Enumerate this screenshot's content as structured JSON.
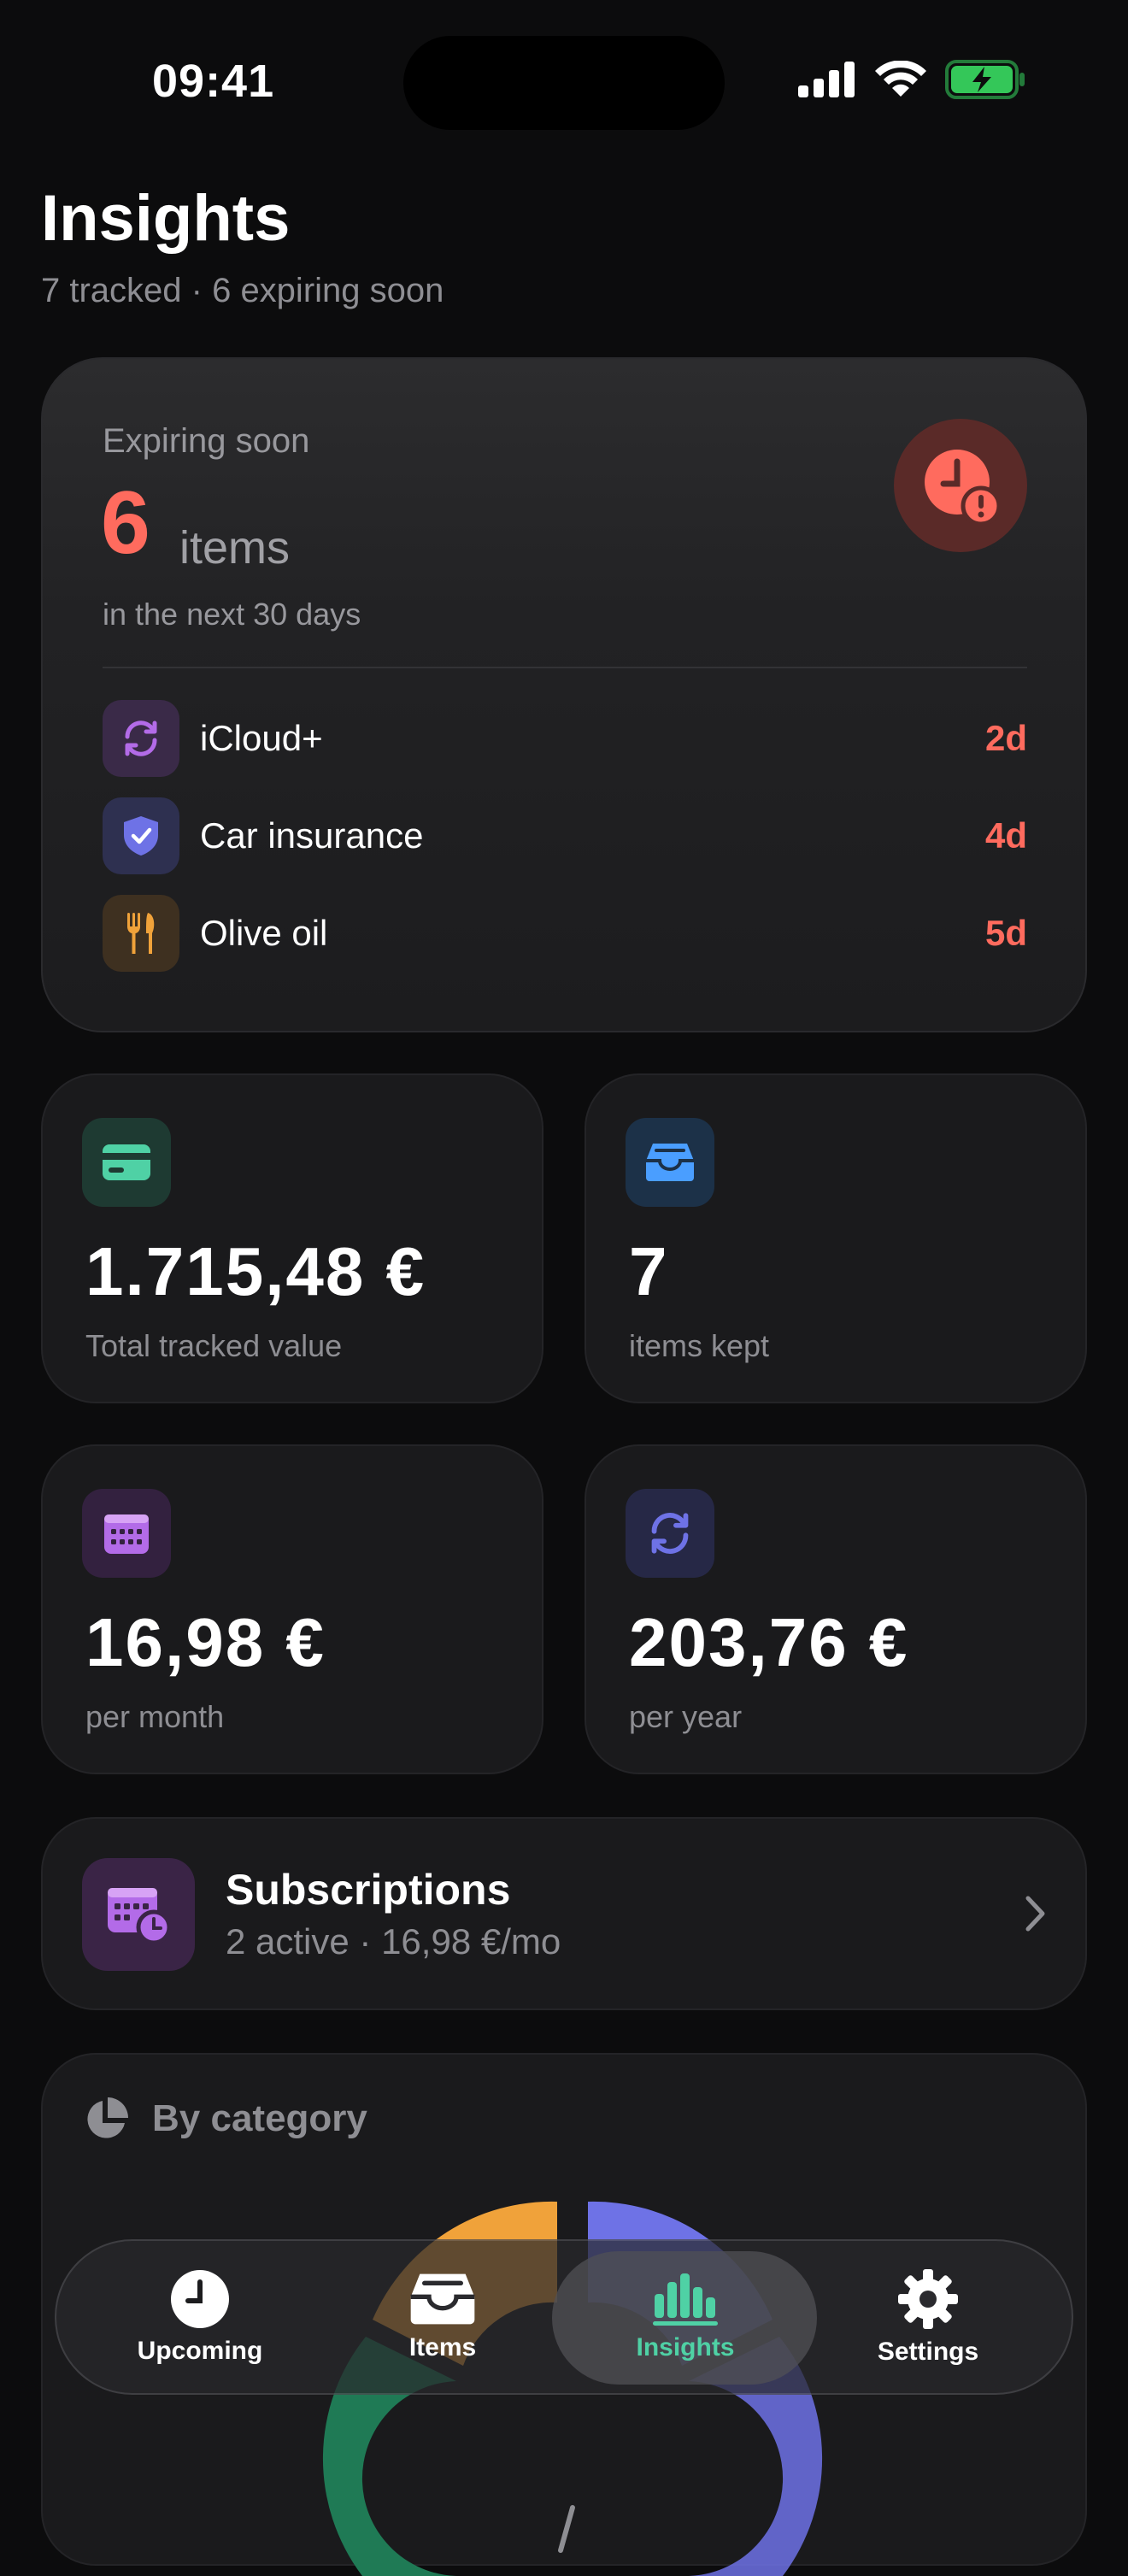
{
  "status_bar": {
    "time": "09:41"
  },
  "header": {
    "title": "Insights",
    "subtitle": "7 tracked · 6 expiring soon"
  },
  "expiring": {
    "label": "Expiring soon",
    "count": "6",
    "unit": "items",
    "note": "in the next 30 days",
    "items": [
      {
        "name": "iCloud+",
        "days": "2d",
        "icon": "sync-icon"
      },
      {
        "name": "Car insurance",
        "days": "4d",
        "icon": "shield-check-icon"
      },
      {
        "name": "Olive oil",
        "days": "5d",
        "icon": "fork-knife-icon"
      }
    ]
  },
  "stats": [
    {
      "value": "1.715,48 €",
      "label": "Total tracked value",
      "icon": "card-icon"
    },
    {
      "value": "7",
      "label": "items kept",
      "icon": "tray-icon"
    },
    {
      "value": "16,98 €",
      "label": "per month",
      "icon": "calendar-icon"
    },
    {
      "value": "203,76 €",
      "label": "per year",
      "icon": "sync-icon"
    }
  ],
  "subscriptions": {
    "title": "Subscriptions",
    "subtitle": "2 active · 16,98 €/mo"
  },
  "category": {
    "title": "By category"
  },
  "tabs": [
    {
      "label": "Upcoming",
      "icon": "clock-icon"
    },
    {
      "label": "Items",
      "icon": "tray-icon"
    },
    {
      "label": "Insights",
      "icon": "chart-bar-icon",
      "active": true
    },
    {
      "label": "Settings",
      "icon": "gear-icon"
    }
  ],
  "colors": {
    "danger": "#ff6b5e",
    "accent_teal": "#4fd1a5",
    "purple": "#b36be8",
    "blue": "#4a9eff",
    "indigo": "#6e72e6",
    "orange": "#f0a23a"
  }
}
